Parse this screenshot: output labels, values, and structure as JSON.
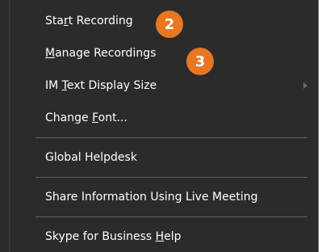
{
  "menu": {
    "items": [
      {
        "pre": "Sta",
        "mnemonic": "r",
        "post": "t Recording"
      },
      {
        "pre": "",
        "mnemonic": "M",
        "post": "anage Recordings"
      },
      {
        "pre": "IM ",
        "mnemonic": "T",
        "post": "ext Display Size"
      },
      {
        "pre": "Change ",
        "mnemonic": "F",
        "post": "ont..."
      },
      {
        "pre": "Global Helpdesk",
        "mnemonic": "",
        "post": ""
      },
      {
        "pre": "Share Information Using Live Meeting",
        "mnemonic": "",
        "post": ""
      },
      {
        "pre": "Skype for Business ",
        "mnemonic": "H",
        "post": "elp"
      }
    ]
  },
  "badges": {
    "b2": "2",
    "b3": "3"
  },
  "colors": {
    "menu_bg": "#2b2b2b",
    "menu_text": "#ffffff",
    "badge": "#e87722",
    "separator": "#5f5f5f"
  }
}
